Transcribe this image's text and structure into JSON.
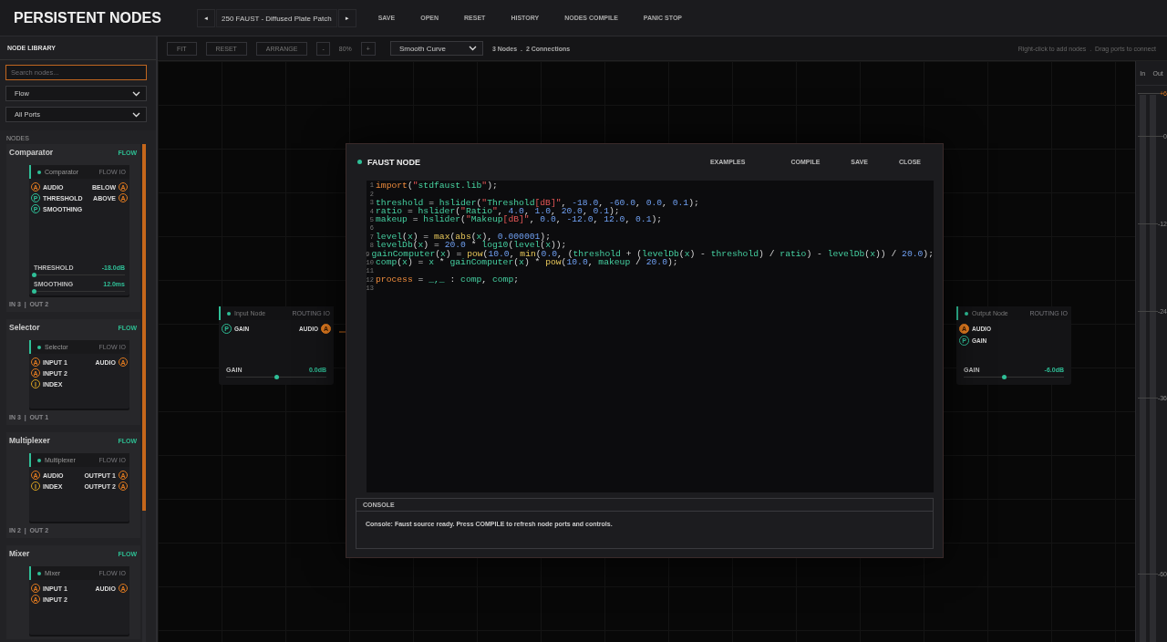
{
  "app": {
    "title": "PERSISTENT NODES"
  },
  "patch": {
    "prev": "◄",
    "name": "250 FAUST - Diffused Plate Patch",
    "next": "►"
  },
  "menu": [
    "SAVE",
    "OPEN",
    "RESET",
    "HISTORY",
    "NODES COMPILE",
    "PANIC STOP"
  ],
  "sidebar": {
    "title": "NODE LIBRARY",
    "search": {
      "placeholder": "Search nodes..."
    },
    "filters": [
      "Flow",
      "All Ports"
    ],
    "section": "NODES",
    "items": [
      {
        "title": "Comparator",
        "tag": "FLOW",
        "preview": {
          "title": "Comparator",
          "meta": "FLOW IO",
          "inputs": [
            {
              "kind": "audio",
              "letter": "A",
              "label": "AUDIO"
            },
            {
              "kind": "param",
              "letter": "P",
              "label": "THRESHOLD"
            },
            {
              "kind": "param",
              "letter": "P",
              "label": "SMOOTHING"
            }
          ],
          "outputs": [
            {
              "kind": "audio",
              "letter": "A",
              "label": "BELOW"
            },
            {
              "kind": "audio",
              "letter": "A",
              "label": "ABOVE"
            }
          ],
          "controls": [
            {
              "label": "THRESHOLD",
              "value": "-18.0dB",
              "level": 0.0
            },
            {
              "label": "SMOOTHING",
              "value": "12.0ms",
              "level": 0.0
            }
          ]
        },
        "footer": "IN 3  |  OUT 2"
      },
      {
        "title": "Selector",
        "tag": "FLOW",
        "preview": {
          "title": "Selector",
          "meta": "FLOW IO",
          "inputs": [
            {
              "kind": "audio",
              "letter": "A",
              "label": "INPUT 1"
            },
            {
              "kind": "audio",
              "letter": "A",
              "label": "INPUT 2"
            },
            {
              "kind": "index",
              "letter": "I",
              "label": "INDEX"
            }
          ],
          "outputs": [
            {
              "kind": "audio",
              "letter": "A",
              "label": "AUDIO"
            }
          ]
        },
        "footer": "IN 3  |  OUT 1"
      },
      {
        "title": "Multiplexer",
        "tag": "FLOW",
        "preview": {
          "title": "Multiplexer",
          "meta": "FLOW IO",
          "inputs": [
            {
              "kind": "audio",
              "letter": "A",
              "label": "AUDIO"
            },
            {
              "kind": "index",
              "letter": "I",
              "label": "INDEX"
            }
          ],
          "outputs": [
            {
              "kind": "audio",
              "letter": "A",
              "label": "OUTPUT 1"
            },
            {
              "kind": "audio",
              "letter": "A",
              "label": "OUTPUT 2"
            }
          ]
        },
        "footer": "IN 2  |  OUT 2"
      },
      {
        "title": "Mixer",
        "tag": "FLOW",
        "preview": {
          "title": "Mixer",
          "meta": "FLOW IO",
          "inputs": [
            {
              "kind": "audio",
              "letter": "A",
              "label": "INPUT 1"
            },
            {
              "kind": "audio",
              "letter": "A",
              "label": "INPUT 2"
            }
          ],
          "outputs": [
            {
              "kind": "audio",
              "letter": "A",
              "label": "AUDIO"
            }
          ]
        }
      }
    ]
  },
  "toolbar": {
    "buttons": [
      "FIT",
      "RESET",
      "ARRANGE"
    ],
    "zoom_out": "-",
    "zoom": "80%",
    "zoom_in": "+",
    "curve": "Smooth Curve",
    "stats": "3 Nodes  .  2 Connections",
    "hint": "Right-click to add nodes  .  Drag ports to connect"
  },
  "canvas_nodes": [
    {
      "title": "Input Node",
      "meta": "ROUTING IO",
      "inputs": [
        {
          "kind": "param",
          "letter": "P",
          "label": "GAIN",
          "connected": false
        }
      ],
      "outputs": [
        {
          "kind": "audio",
          "letter": "A",
          "label": "AUDIO",
          "connected": true
        }
      ],
      "control": {
        "label": "GAIN",
        "value": "0.0dB",
        "level": 0.5
      }
    },
    {
      "title": "Output Node",
      "meta": "ROUTING IO",
      "inputs": [
        {
          "kind": "audio",
          "letter": "A",
          "label": "AUDIO",
          "connected": true
        },
        {
          "kind": "param",
          "letter": "P",
          "label": "GAIN",
          "connected": false
        }
      ],
      "control": {
        "label": "GAIN",
        "value": "-6.0dB",
        "level": 0.4
      }
    }
  ],
  "meters": {
    "labels": [
      "In",
      "Out"
    ],
    "ticks": [
      {
        "label": "+6",
        "kind": "peak"
      },
      {
        "label": "0",
        "kind": "normal"
      },
      {
        "label": "-12",
        "kind": "normal"
      },
      {
        "label": "-24",
        "kind": "normal"
      },
      {
        "label": "-36",
        "kind": "normal"
      },
      {
        "label": "-60",
        "kind": "normal"
      }
    ]
  },
  "dialog": {
    "title": "FAUST NODE",
    "actions": [
      "EXAMPLES",
      "COMPILE",
      "SAVE",
      "CLOSE"
    ],
    "code": [
      {
        "n": "1",
        "tokens": [
          {
            "kind": "kw",
            "text": "import"
          },
          {
            "kind": "p",
            "text": "("
          },
          {
            "kind": "q",
            "text": "\""
          },
          {
            "kind": "s",
            "text": "stdfaust.lib"
          },
          {
            "kind": "q",
            "text": "\""
          },
          {
            "kind": "p",
            "text": ");"
          }
        ]
      },
      {
        "n": "2"
      },
      {
        "n": "3",
        "tokens": [
          {
            "kind": "i",
            "text": "threshold"
          },
          {
            "kind": "p",
            "text": " = "
          },
          {
            "kind": "i",
            "text": "hslider"
          },
          {
            "kind": "p",
            "text": "("
          },
          {
            "kind": "q",
            "text": "\""
          },
          {
            "kind": "s",
            "text": "Threshold"
          },
          {
            "kind": "q",
            "text": "[dB]\""
          },
          {
            "kind": "p",
            "text": ", "
          },
          {
            "kind": "n",
            "text": "-18.0"
          },
          {
            "kind": "p",
            "text": ", "
          },
          {
            "kind": "n",
            "text": "-60.0"
          },
          {
            "kind": "p",
            "text": ", "
          },
          {
            "kind": "n",
            "text": "0.0"
          },
          {
            "kind": "p",
            "text": ", "
          },
          {
            "kind": "n",
            "text": "0.1"
          },
          {
            "kind": "p",
            "text": ");"
          }
        ]
      },
      {
        "n": "4",
        "tokens": [
          {
            "kind": "i",
            "text": "ratio"
          },
          {
            "kind": "p",
            "text": " = "
          },
          {
            "kind": "i",
            "text": "hslider"
          },
          {
            "kind": "p",
            "text": "("
          },
          {
            "kind": "q",
            "text": "\""
          },
          {
            "kind": "s",
            "text": "Ratio"
          },
          {
            "kind": "q",
            "text": "\""
          },
          {
            "kind": "p",
            "text": ", "
          },
          {
            "kind": "n",
            "text": "4.0"
          },
          {
            "kind": "p",
            "text": ", "
          },
          {
            "kind": "n",
            "text": "1.0"
          },
          {
            "kind": "p",
            "text": ", "
          },
          {
            "kind": "n",
            "text": "20.0"
          },
          {
            "kind": "p",
            "text": ", "
          },
          {
            "kind": "n",
            "text": "0.1"
          },
          {
            "kind": "p",
            "text": ");"
          }
        ]
      },
      {
        "n": "5",
        "tokens": [
          {
            "kind": "i",
            "text": "makeup"
          },
          {
            "kind": "p",
            "text": " = "
          },
          {
            "kind": "i",
            "text": "hslider"
          },
          {
            "kind": "p",
            "text": "("
          },
          {
            "kind": "q",
            "text": "\""
          },
          {
            "kind": "s",
            "text": "Makeup"
          },
          {
            "kind": "q",
            "text": "[dB]\""
          },
          {
            "kind": "p",
            "text": ", "
          },
          {
            "kind": "n",
            "text": "0.0"
          },
          {
            "kind": "p",
            "text": ", "
          },
          {
            "kind": "n",
            "text": "-12.0"
          },
          {
            "kind": "p",
            "text": ", "
          },
          {
            "kind": "n",
            "text": "12.0"
          },
          {
            "kind": "p",
            "text": ", "
          },
          {
            "kind": "n",
            "text": "0.1"
          },
          {
            "kind": "p",
            "text": ");"
          }
        ]
      },
      {
        "n": "6"
      },
      {
        "n": "7",
        "tokens": [
          {
            "kind": "i",
            "text": "level"
          },
          {
            "kind": "p",
            "text": "("
          },
          {
            "kind": "i",
            "text": "x"
          },
          {
            "kind": "p",
            "text": ") = "
          },
          {
            "kind": "f",
            "text": "max"
          },
          {
            "kind": "p",
            "text": "("
          },
          {
            "kind": "f",
            "text": "abs"
          },
          {
            "kind": "p",
            "text": "("
          },
          {
            "kind": "i",
            "text": "x"
          },
          {
            "kind": "p",
            "text": "), "
          },
          {
            "kind": "n",
            "text": "0.000001"
          },
          {
            "kind": "p",
            "text": ");"
          }
        ]
      },
      {
        "n": "8",
        "tokens": [
          {
            "kind": "i",
            "text": "levelDb"
          },
          {
            "kind": "p",
            "text": "("
          },
          {
            "kind": "i",
            "text": "x"
          },
          {
            "kind": "p",
            "text": ") = "
          },
          {
            "kind": "n",
            "text": "20.0"
          },
          {
            "kind": "p",
            "text": " * "
          },
          {
            "kind": "i",
            "text": "log10"
          },
          {
            "kind": "p",
            "text": "("
          },
          {
            "kind": "i",
            "text": "level"
          },
          {
            "kind": "p",
            "text": "("
          },
          {
            "kind": "i",
            "text": "x"
          },
          {
            "kind": "p",
            "text": "));"
          }
        ]
      },
      {
        "n": "9",
        "tokens": [
          {
            "kind": "i",
            "text": "gainComputer"
          },
          {
            "kind": "p",
            "text": "("
          },
          {
            "kind": "i",
            "text": "x"
          },
          {
            "kind": "p",
            "text": ") = "
          },
          {
            "kind": "f",
            "text": "pow"
          },
          {
            "kind": "p",
            "text": "("
          },
          {
            "kind": "n",
            "text": "10.0"
          },
          {
            "kind": "p",
            "text": ", "
          },
          {
            "kind": "f",
            "text": "min"
          },
          {
            "kind": "p",
            "text": "("
          },
          {
            "kind": "n",
            "text": "0.0"
          },
          {
            "kind": "p",
            "text": ", ("
          },
          {
            "kind": "i",
            "text": "threshold"
          },
          {
            "kind": "p",
            "text": " + ("
          },
          {
            "kind": "i",
            "text": "levelDb"
          },
          {
            "kind": "p",
            "text": "("
          },
          {
            "kind": "i",
            "text": "x"
          },
          {
            "kind": "p",
            "text": ") - "
          },
          {
            "kind": "i",
            "text": "threshold"
          },
          {
            "kind": "p",
            "text": ") / "
          },
          {
            "kind": "i",
            "text": "ratio"
          },
          {
            "kind": "p",
            "text": ") - "
          },
          {
            "kind": "i",
            "text": "levelDb"
          },
          {
            "kind": "p",
            "text": "("
          },
          {
            "kind": "i",
            "text": "x"
          },
          {
            "kind": "p",
            "text": ")) / "
          },
          {
            "kind": "n",
            "text": "20.0"
          },
          {
            "kind": "p",
            "text": ");"
          }
        ]
      },
      {
        "n": "10",
        "tokens": [
          {
            "kind": "i",
            "text": "comp"
          },
          {
            "kind": "p",
            "text": "("
          },
          {
            "kind": "i",
            "text": "x"
          },
          {
            "kind": "p",
            "text": ") = "
          },
          {
            "kind": "i",
            "text": "x"
          },
          {
            "kind": "p",
            "text": " * "
          },
          {
            "kind": "i",
            "text": "gainComputer"
          },
          {
            "kind": "p",
            "text": "("
          },
          {
            "kind": "i",
            "text": "x"
          },
          {
            "kind": "p",
            "text": ") * "
          },
          {
            "kind": "f",
            "text": "pow"
          },
          {
            "kind": "p",
            "text": "("
          },
          {
            "kind": "n",
            "text": "10.0"
          },
          {
            "kind": "p",
            "text": ", "
          },
          {
            "kind": "i",
            "text": "makeup"
          },
          {
            "kind": "p",
            "text": " / "
          },
          {
            "kind": "n",
            "text": "20.0"
          },
          {
            "kind": "p",
            "text": ");"
          }
        ]
      },
      {
        "n": "11"
      },
      {
        "n": "12",
        "tokens": [
          {
            "kind": "kw",
            "text": "process"
          },
          {
            "kind": "p",
            "text": " = "
          },
          {
            "kind": "i",
            "text": "_,_"
          },
          {
            "kind": "p",
            "text": " : "
          },
          {
            "kind": "i",
            "text": "comp"
          },
          {
            "kind": "p",
            "text": ", "
          },
          {
            "kind": "i",
            "text": "comp"
          },
          {
            "kind": "p",
            "text": ";"
          }
        ]
      },
      {
        "n": "13"
      }
    ],
    "console": {
      "title": "CONSOLE",
      "message": "Console: Faust source ready. Press COMPILE to refresh node ports and controls."
    }
  }
}
